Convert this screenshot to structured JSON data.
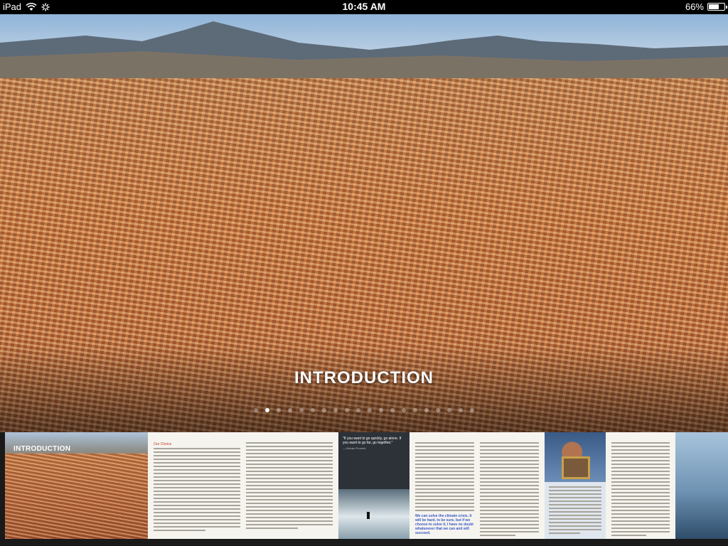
{
  "status_bar": {
    "device": "iPad",
    "time": "10:45 AM",
    "battery": "66%",
    "battery_level": 0.66
  },
  "hero": {
    "title": "INTRODUCTION"
  },
  "pagination": {
    "total": 20,
    "active_index": 1
  },
  "thumbnails": {
    "first_label": "INTRODUCTION",
    "page2_heading": "Our Choice",
    "page3_quote": "\"If you want to go quickly, go alone. If you want to go far, go together.\"",
    "page3_quote_by": "— African Proverb",
    "page4_callout": "We can solve the climate crisis. It will be hard, to be sure, but if we choose to solve it, I have no doubt whatsoever that we can and will succeed."
  },
  "colors": {
    "status_bg": "#000000",
    "status_text": "#ffffff",
    "accent_red": "#c0392b",
    "callout_blue": "#3a58c9"
  }
}
